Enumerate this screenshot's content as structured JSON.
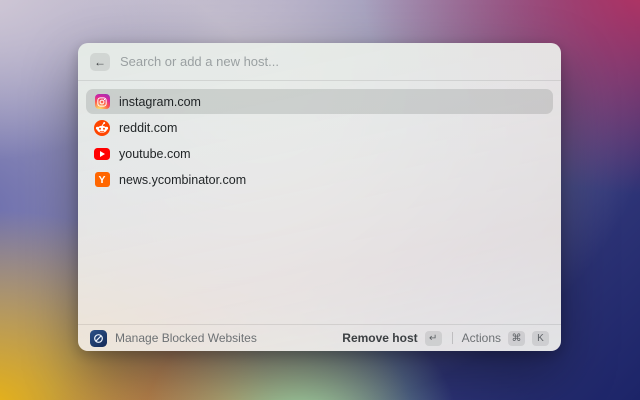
{
  "window": {
    "search": {
      "placeholder": "Search or add a new host...",
      "back_icon_glyph": "←"
    },
    "list": {
      "items": [
        {
          "label": "instagram.com",
          "icon": "instagram-icon",
          "selected": true
        },
        {
          "label": "reddit.com",
          "icon": "reddit-icon",
          "selected": false
        },
        {
          "label": "youtube.com",
          "icon": "youtube-icon",
          "selected": false
        },
        {
          "label": "news.ycombinator.com",
          "icon": "ycombinator-icon",
          "selected": false
        }
      ]
    },
    "footer": {
      "app_icon": "blocked-circle-icon",
      "app_label": "Manage Blocked Websites",
      "primary_action": {
        "label": "Remove host",
        "key_glyph": "↵"
      },
      "divider": "|",
      "secondary_action": {
        "label": "Actions",
        "keys": [
          "⌘",
          "K"
        ]
      }
    }
  },
  "colors": {
    "reddit": "#FF4500",
    "youtube": "#FF0000",
    "ycombinator": "#FF6600",
    "instagram_gradient_stops": [
      "#fdf497",
      "#fd5949",
      "#d6249f",
      "#8a3ab9"
    ],
    "extension_icon_navy": "#1d3a6b",
    "selection_gray": "rgba(60,66,62,0.16)"
  }
}
